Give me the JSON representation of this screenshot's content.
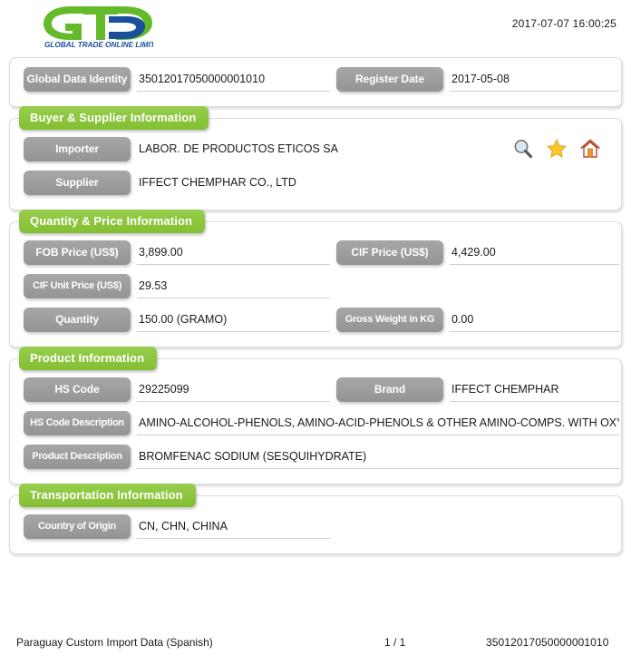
{
  "header": {
    "logo_main_text": "GTO",
    "logo_sub_text": "GLOBAL TRADE ONLINE LIMITED",
    "datetime": "2017-07-07 16:00:25",
    "brand_green": "#8cc63e",
    "brand_blue": "#1b4f9c"
  },
  "identity_panel": {
    "global_data_identity_label": "Global Data Identity",
    "global_data_identity_value": "35012017050000001010",
    "register_date_label": "Register Date",
    "register_date_value": "2017-05-08"
  },
  "buyer_supplier": {
    "section_title": "Buyer & Supplier Information",
    "importer_label": "Importer",
    "importer_value": "LABOR. DE PRODUCTOS ETICOS SA",
    "supplier_label": "Supplier",
    "supplier_value": "IFFECT CHEMPHAR CO., LTD",
    "icons": [
      "search-icon",
      "star-icon",
      "home-icon"
    ]
  },
  "quantity_price": {
    "section_title": "Quantity & Price Information",
    "fob_price_label": "FOB Price (US$)",
    "fob_price_value": "3,899.00",
    "cif_price_label": "CIF Price (US$)",
    "cif_price_value": "4,429.00",
    "cif_unit_price_label": "CIF Unit Price (US$)",
    "cif_unit_price_value": "29.53",
    "quantity_label": "Quantity",
    "quantity_value": "150.00 (GRAMO)",
    "gross_weight_label": "Gross Weight in KG",
    "gross_weight_value": "0.00"
  },
  "product": {
    "section_title": "Product Information",
    "hs_code_label": "HS Code",
    "hs_code_value": "29225099",
    "brand_label": "Brand",
    "brand_value": "IFFECT CHEMPHAR",
    "hs_code_description_label": "HS Code Description",
    "hs_code_description_value": "AMINO-ALCOHOL-PHENOLS, AMINO-ACID-PHENOLS & OTHER AMINO-COMPS. WITH OXYGEN FUNCTION",
    "product_description_label": "Product Description",
    "product_description_value": "BROMFENAC SODIUM (SESQUIHYDRATE)"
  },
  "transportation": {
    "section_title": "Transportation Information",
    "country_of_origin_label": "Country of Origin",
    "country_of_origin_value": "CN, CHN, CHINA"
  },
  "footer": {
    "dataset": "Paraguay Custom Import Data (Spanish)",
    "page": "1 / 1",
    "record_id": "35012017050000001010"
  }
}
